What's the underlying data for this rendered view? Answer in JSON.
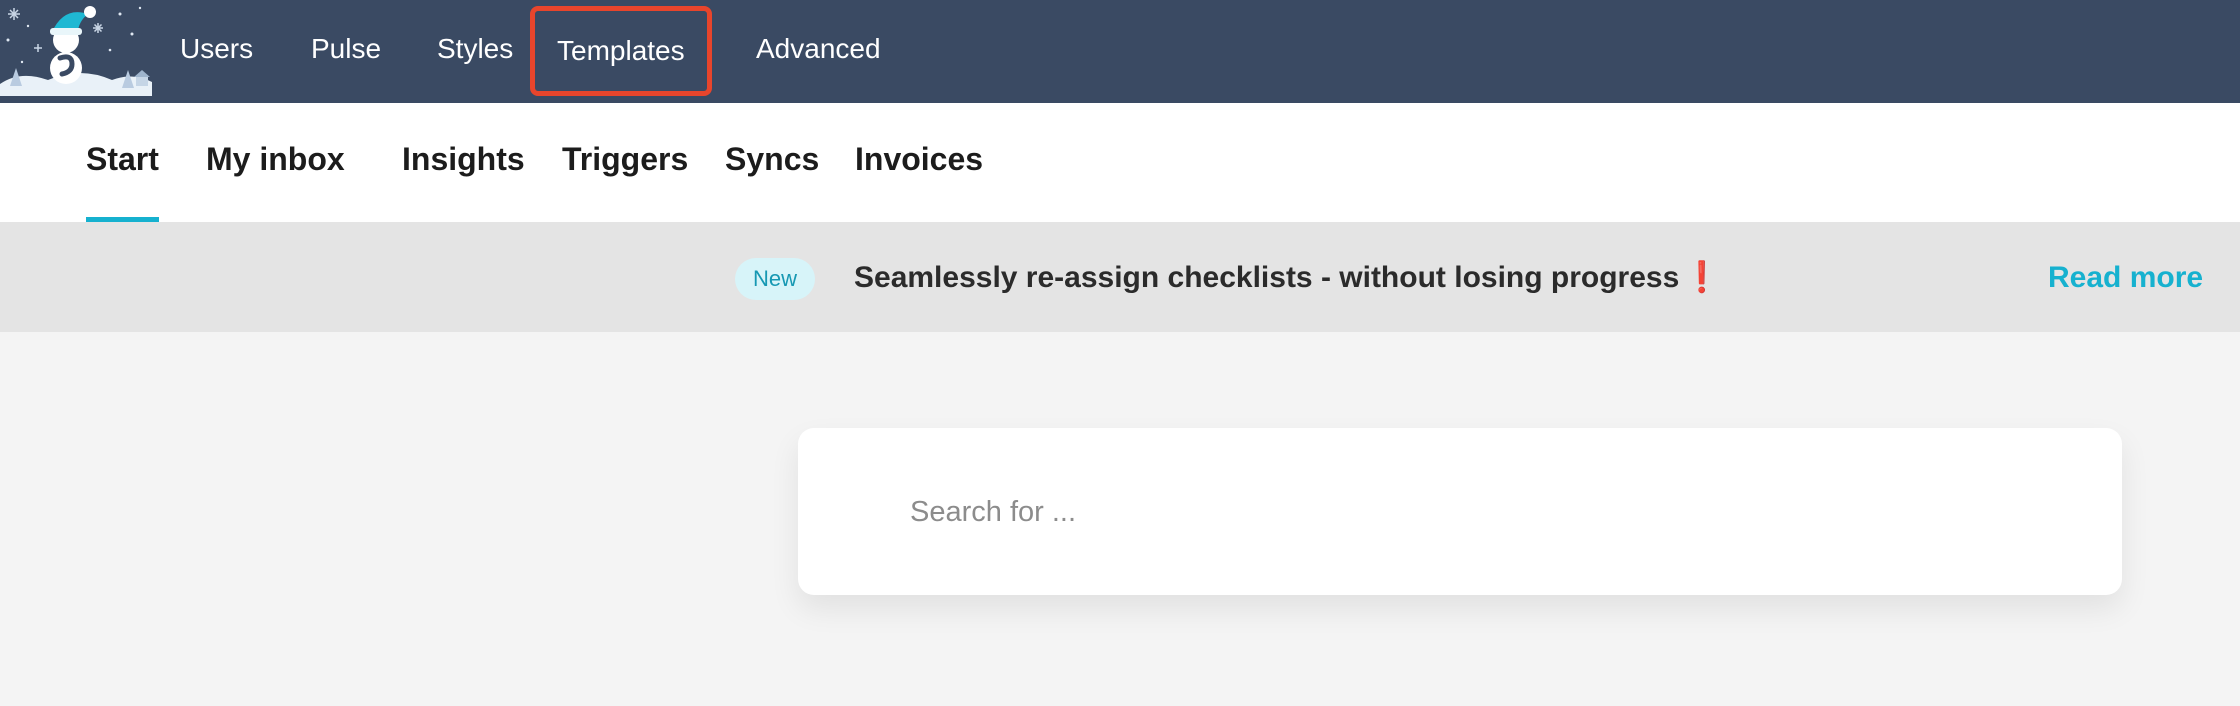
{
  "topnav": {
    "items": [
      {
        "label": "Users"
      },
      {
        "label": "Pulse"
      },
      {
        "label": "Styles"
      },
      {
        "label": "Templates"
      },
      {
        "label": "Advanced"
      }
    ],
    "highlighted": "Templates",
    "highlight_color": "#e8452c",
    "background_color": "#3a4a63"
  },
  "logo": {
    "icon": "snowman-logo-icon"
  },
  "subtabs": {
    "items": [
      {
        "label": "Start"
      },
      {
        "label": "My inbox"
      },
      {
        "label": "Insights"
      },
      {
        "label": "Triggers"
      },
      {
        "label": "Syncs"
      },
      {
        "label": "Invoices"
      }
    ],
    "active": "Start",
    "active_color": "#16b1cf"
  },
  "banner": {
    "badge": "New",
    "message": "Seamlessly re-assign checklists - without losing progress",
    "exclaim": "❗",
    "link": "Read more"
  },
  "search": {
    "placeholder": "Search for ...",
    "value": ""
  }
}
